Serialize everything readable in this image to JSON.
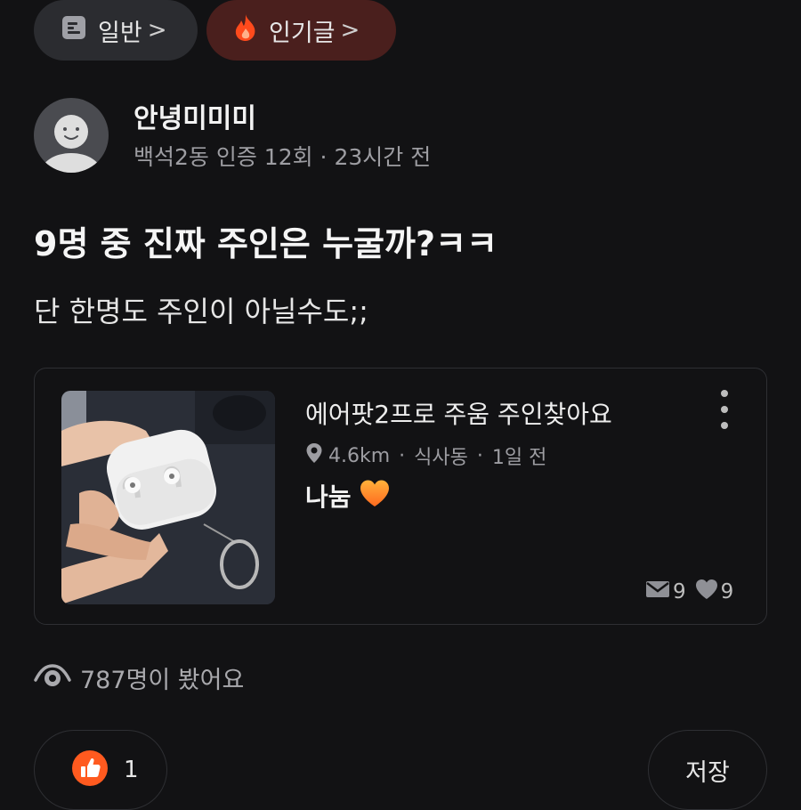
{
  "filters": {
    "general_label": "일반",
    "popular_label": "인기글",
    "chevron": ">"
  },
  "author": {
    "name": "안녕미미미",
    "meta": "백석2동 인증 12회 · 23시간 전"
  },
  "post": {
    "title": "9명 중 진짜 주인은 누굴까?ㅋㅋ",
    "body": "단 한명도 주인이 아닐수도;;"
  },
  "listing": {
    "title": "에어팟2프로 주움 주인찾아요",
    "distance": "4.6km",
    "location": "식사동",
    "time": "1일 전",
    "separator": "·",
    "price": "나눔",
    "chats": "9",
    "likes": "9"
  },
  "views": "787명이 봤어요",
  "actions": {
    "like_count": "1",
    "save_label": "저장"
  },
  "colors": {
    "background": "#121214",
    "accent_orange": "#ff5a1f",
    "popular_chip_bg": "#4a1f1d",
    "chip_bg": "#2b2c30"
  }
}
